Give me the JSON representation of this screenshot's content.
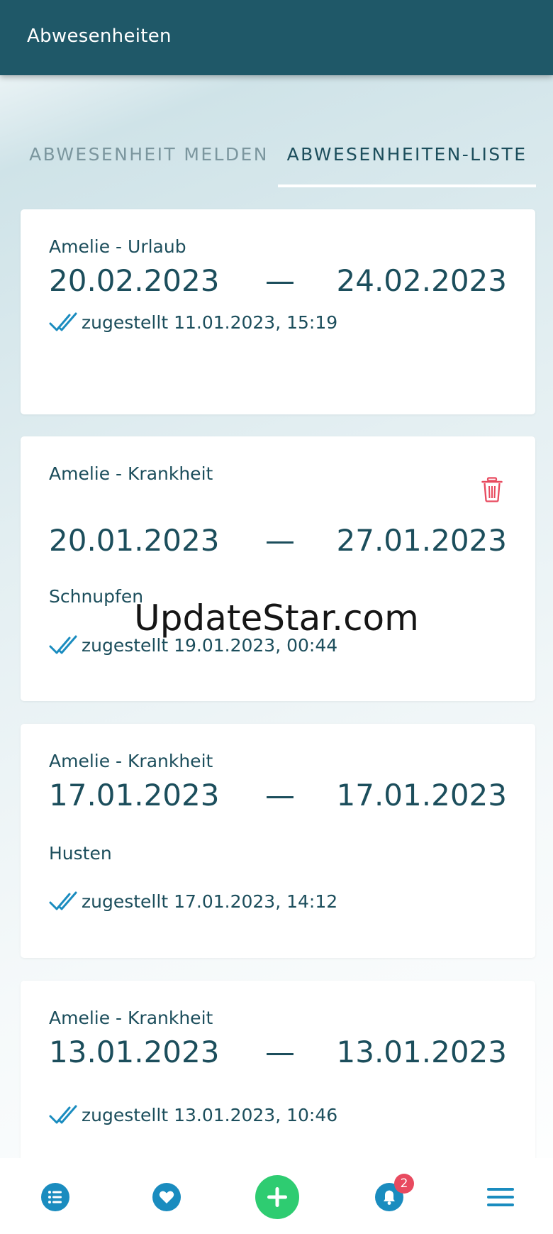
{
  "appbar": {
    "title": "Abwesenheiten"
  },
  "tabs": [
    {
      "label": "ABWESENHEIT MELDEN",
      "active": false
    },
    {
      "label": "ABWESENHEITEN-LISTE",
      "active": true
    }
  ],
  "absences": [
    {
      "title": "Amelie - Urlaub",
      "from": "20.02.2023",
      "sep": "—",
      "to": "24.02.2023",
      "note": "",
      "status": "zugestellt 11.01.2023, 15:19",
      "deletable": false
    },
    {
      "title": "Amelie - Krankheit",
      "from": "20.01.2023",
      "sep": "—",
      "to": "27.01.2023",
      "note": "Schnupfen",
      "status": "zugestellt 19.01.2023, 00:44",
      "deletable": true
    },
    {
      "title": "Amelie - Krankheit",
      "from": "17.01.2023",
      "sep": "—",
      "to": "17.01.2023",
      "note": "Husten",
      "status": "zugestellt 17.01.2023, 14:12",
      "deletable": false
    },
    {
      "title": "Amelie - Krankheit",
      "from": "13.01.2023",
      "sep": "—",
      "to": "13.01.2023",
      "note": "",
      "status": "zugestellt 13.01.2023, 10:46",
      "deletable": false
    }
  ],
  "watermark": "UpdateStar.com",
  "nav": {
    "items": [
      "list-icon",
      "heart-icon",
      "plus-icon",
      "bell-icon",
      "menu-icon"
    ],
    "notification_count": "2"
  },
  "colors": {
    "appbar": "#1f5868",
    "text": "#1c4e5c",
    "accent_green": "#2ecc71",
    "icon_blue": "#1a8cbf",
    "delete_red": "#e84a5f"
  }
}
